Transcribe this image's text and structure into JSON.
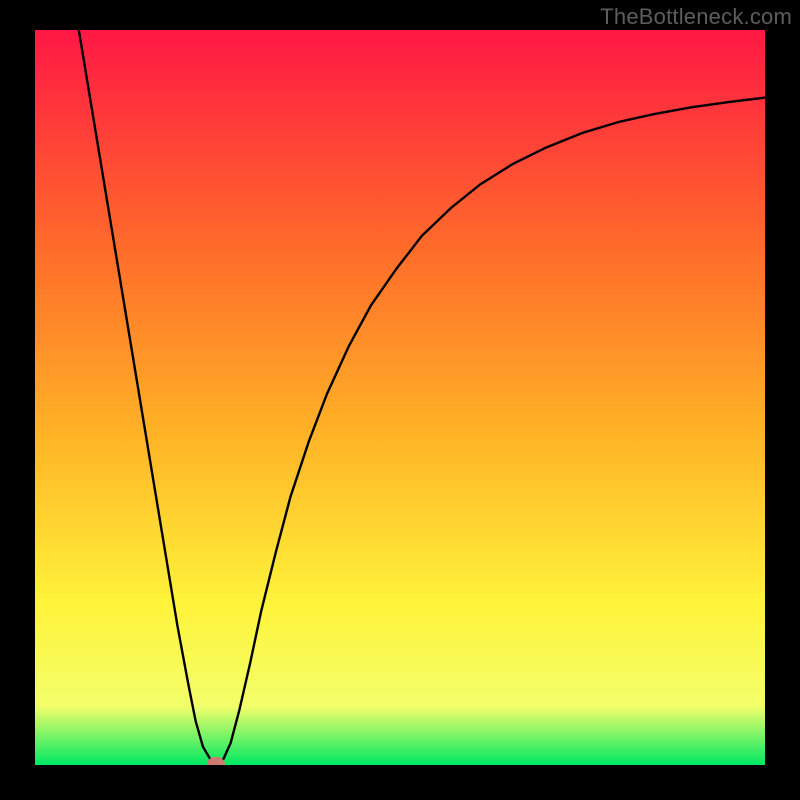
{
  "watermark": "TheBottleneck.com",
  "colors": {
    "bg": "#000000",
    "gradient_top": "#ff1845",
    "gradient_mid1": "#ff6c2a",
    "gradient_mid2": "#ffb326",
    "gradient_mid3": "#fff33a",
    "gradient_mid4": "#f3ff6a",
    "gradient_bottom": "#00e863",
    "curve": "#000000",
    "marker_fill": "#cd7b71",
    "watermark": "#5d5d5d"
  },
  "chart_data": {
    "type": "line",
    "title": "",
    "xlabel": "",
    "ylabel": "",
    "x_range": [
      0,
      100
    ],
    "y_range": [
      0,
      100
    ],
    "series": [
      {
        "name": "bottleneck-curve",
        "points": [
          {
            "x": 6.0,
            "y": 100.0
          },
          {
            "x": 7.5,
            "y": 91.0
          },
          {
            "x": 9.0,
            "y": 82.0
          },
          {
            "x": 10.5,
            "y": 73.0
          },
          {
            "x": 12.0,
            "y": 64.0
          },
          {
            "x": 13.5,
            "y": 55.0
          },
          {
            "x": 15.0,
            "y": 46.0
          },
          {
            "x": 16.5,
            "y": 37.0
          },
          {
            "x": 18.0,
            "y": 28.0
          },
          {
            "x": 19.5,
            "y": 19.0
          },
          {
            "x": 21.0,
            "y": 11.0
          },
          {
            "x": 22.0,
            "y": 6.0
          },
          {
            "x": 23.0,
            "y": 2.5
          },
          {
            "x": 24.0,
            "y": 0.8
          },
          {
            "x": 24.8,
            "y": 0.2
          },
          {
            "x": 25.8,
            "y": 0.8
          },
          {
            "x": 26.8,
            "y": 3.0
          },
          {
            "x": 28.0,
            "y": 7.5
          },
          {
            "x": 29.5,
            "y": 14.0
          },
          {
            "x": 31.0,
            "y": 21.0
          },
          {
            "x": 33.0,
            "y": 29.0
          },
          {
            "x": 35.0,
            "y": 36.5
          },
          {
            "x": 37.5,
            "y": 44.0
          },
          {
            "x": 40.0,
            "y": 50.5
          },
          {
            "x": 43.0,
            "y": 57.0
          },
          {
            "x": 46.0,
            "y": 62.5
          },
          {
            "x": 49.5,
            "y": 67.5
          },
          {
            "x": 53.0,
            "y": 72.0
          },
          {
            "x": 57.0,
            "y": 75.8
          },
          {
            "x": 61.0,
            "y": 79.0
          },
          {
            "x": 65.5,
            "y": 81.8
          },
          {
            "x": 70.0,
            "y": 84.0
          },
          {
            "x": 75.0,
            "y": 86.0
          },
          {
            "x": 80.0,
            "y": 87.5
          },
          {
            "x": 85.0,
            "y": 88.6
          },
          {
            "x": 90.0,
            "y": 89.5
          },
          {
            "x": 95.0,
            "y": 90.2
          },
          {
            "x": 100.0,
            "y": 90.8
          }
        ]
      }
    ],
    "marker": {
      "x": 24.8,
      "y": 0.2,
      "rx": 1.2,
      "ry": 0.9
    }
  }
}
